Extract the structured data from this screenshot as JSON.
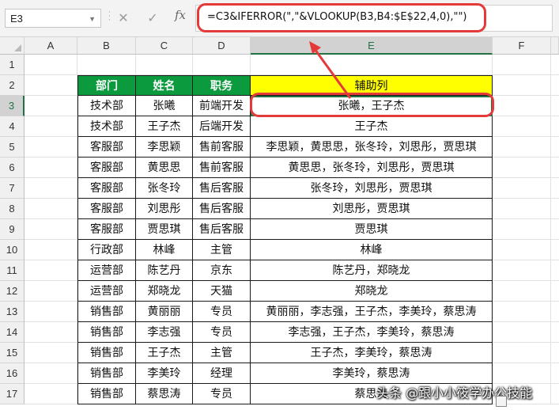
{
  "formula_bar": {
    "name_box": "E3",
    "formula": "=C3&IFERROR(\",\"&VLOOKUP(B3,B4:$E$22,4,0),\"\")",
    "cancel_icon": "close-icon",
    "enter_icon": "check-icon",
    "function_icon": "fx-icon"
  },
  "columns": [
    "A",
    "B",
    "C",
    "D",
    "E",
    "F"
  ],
  "rows": [
    "1",
    "2",
    "3",
    "4",
    "5",
    "6",
    "7",
    "8",
    "9",
    "10",
    "11",
    "12",
    "13",
    "14",
    "15",
    "16",
    "17"
  ],
  "table": {
    "headers": [
      "部门",
      "姓名",
      "职务",
      "辅助列"
    ],
    "data": [
      [
        "技术部",
        "张曦",
        "前端开发",
        "张曦，王子杰"
      ],
      [
        "技术部",
        "王子杰",
        "后端开发",
        "王子杰"
      ],
      [
        "客服部",
        "李思颖",
        "售前客服",
        "李思颖，黄思思，张冬玲，刘思彤，贾思琪"
      ],
      [
        "客服部",
        "黄思思",
        "售前客服",
        "黄思思，张冬玲，刘思彤，贾思琪"
      ],
      [
        "客服部",
        "张冬玲",
        "售后客服",
        "张冬玲，刘思彤，贾思琪"
      ],
      [
        "客服部",
        "刘思彤",
        "售后客服",
        "刘思彤，贾思琪"
      ],
      [
        "客服部",
        "贾思琪",
        "售后客服",
        "贾思琪"
      ],
      [
        "行政部",
        "林峰",
        "主管",
        "林峰"
      ],
      [
        "运营部",
        "陈艺丹",
        "京东",
        "陈艺丹，郑晓龙"
      ],
      [
        "运营部",
        "郑晓龙",
        "天猫",
        "郑晓龙"
      ],
      [
        "销售部",
        "黄丽丽",
        "专员",
        "黄丽丽，李志强，王子杰，李美玲，蔡思涛"
      ],
      [
        "销售部",
        "李志强",
        "专员",
        "李志强，王子杰，李美玲，蔡思涛"
      ],
      [
        "销售部",
        "王子杰",
        "主管",
        "王子杰，李美玲，蔡思涛"
      ],
      [
        "销售部",
        "李美玲",
        "经理",
        "李美玲，蔡思涛"
      ],
      [
        "销售部",
        "蔡思涛",
        "专员",
        "蔡思涛"
      ]
    ]
  },
  "colors": {
    "header_green": "#0b9a3e",
    "header_yellow": "#ffff00",
    "highlight_red": "#e53a3a",
    "excel_green": "#217346"
  },
  "watermark": "头条 @跟小小筱学办公技能"
}
